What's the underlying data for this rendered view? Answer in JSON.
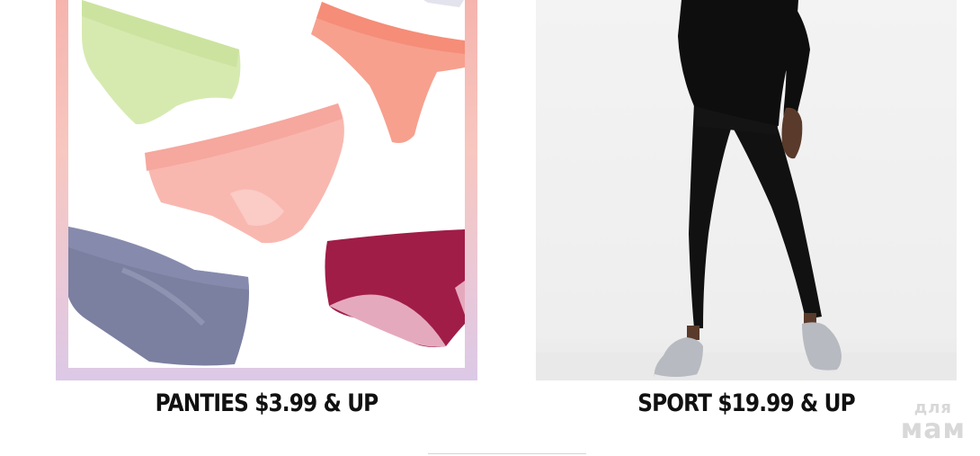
{
  "promos": [
    {
      "caption": "PANTIES $3.99 & UP"
    },
    {
      "caption": "SPORT $19.99 & UP"
    }
  ],
  "watermark": {
    "line1": "для",
    "line2": "мам"
  },
  "colors": {
    "frame_top": "#f6b4ae",
    "frame_bottom": "#dcc9e6",
    "caption_text": "#111111",
    "panty_green": "#d6eab0",
    "panty_coral": "#f7a08e",
    "panty_pink": "#f8b8b0",
    "panty_slate": "#7b7fa0",
    "panty_berry": "#a01d48"
  },
  "icons": [
    "panties-illustration",
    "model-photo"
  ]
}
